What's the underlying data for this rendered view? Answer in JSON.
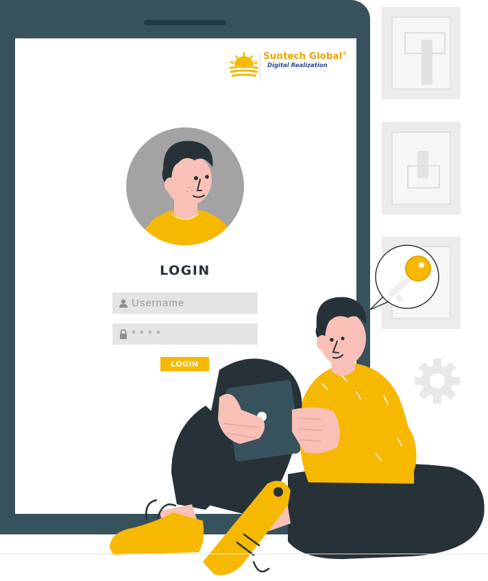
{
  "brand": {
    "name": "Suntech Global",
    "registered_mark": "®",
    "tagline": "Digital Realization"
  },
  "login": {
    "title": "LOGIN",
    "username_placeholder": "Username",
    "password_value": "* * * *",
    "button_label": "LOGIN"
  },
  "colors": {
    "tablet": "#37525c",
    "accent_yellow": "#f6b800",
    "brand_yellow": "#e8a500",
    "brand_blue": "#2f4a9a",
    "skin": "#f8c0b6",
    "hair": "#263238",
    "field_bg": "#e4e4e4"
  },
  "icons": {
    "username": "user-icon",
    "password": "lock-icon",
    "key_bubble": "key-icon",
    "settings": "gear-icon"
  }
}
